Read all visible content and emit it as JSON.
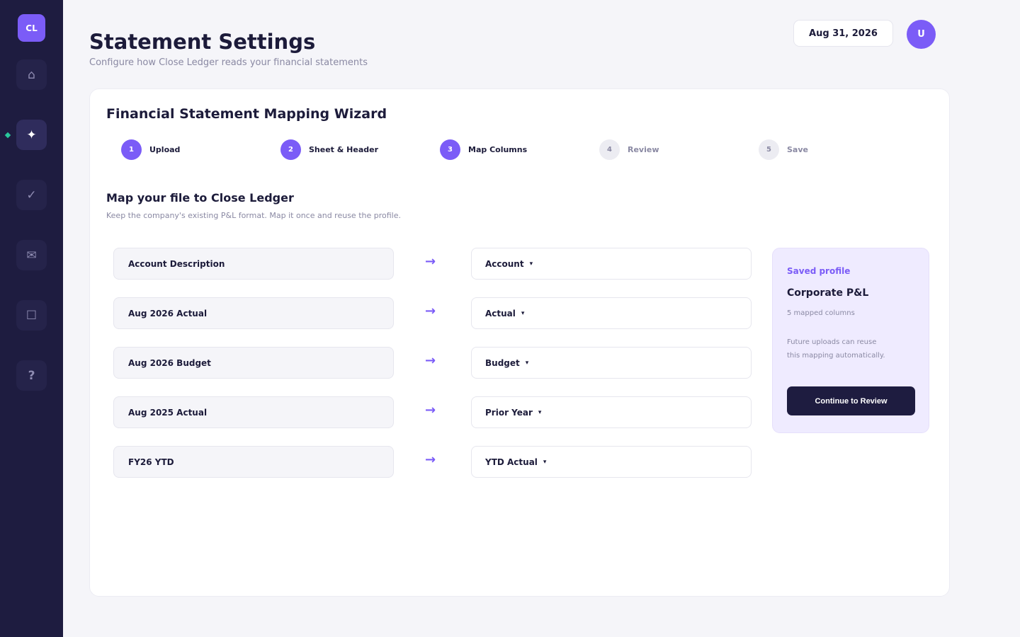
{
  "sidebar": {
    "logo": "CL",
    "items": [
      {
        "name": "home",
        "icon": "⌂"
      },
      {
        "name": "sparkle",
        "icon": "✦"
      },
      {
        "name": "check",
        "icon": "✓"
      },
      {
        "name": "mail",
        "icon": "✉"
      },
      {
        "name": "square",
        "icon": "☐"
      },
      {
        "name": "help",
        "icon": "?"
      }
    ],
    "active_index": 1
  },
  "header": {
    "title": "Statement Settings",
    "subtitle": "Configure how Close Ledger reads your financial statements",
    "date": "Aug 31, 2026",
    "avatar_initial": "U"
  },
  "wizard": {
    "title": "Financial Statement Mapping Wizard",
    "steps": [
      {
        "number": "1",
        "label": "Upload",
        "status": "done"
      },
      {
        "number": "2",
        "label": "Sheet & Header",
        "status": "done"
      },
      {
        "number": "3",
        "label": "Map Columns",
        "status": "done"
      },
      {
        "number": "4",
        "label": "Review",
        "status": "todo"
      },
      {
        "number": "5",
        "label": "Save",
        "status": "todo"
      }
    ],
    "section_title": "Map your file to Close Ledger",
    "section_subtitle": "Keep the company's existing P&L format. Map it once and reuse the profile.",
    "arrow": "→",
    "caret": "▾",
    "mappings": [
      {
        "source": "Account Description",
        "target": "Account"
      },
      {
        "source": "Aug 2026 Actual",
        "target": "Actual"
      },
      {
        "source": "Aug 2026 Budget",
        "target": "Budget"
      },
      {
        "source": "Aug 2025 Actual",
        "target": "Prior Year"
      },
      {
        "source": "FY26 YTD",
        "target": "YTD Actual"
      }
    ]
  },
  "profile": {
    "kicker": "Saved profile",
    "name": "Corporate P&L",
    "count": "5 mapped columns",
    "note_line1": "Future uploads can reuse",
    "note_line2": "this mapping automatically.",
    "cta": "Continue to Review"
  },
  "colors": {
    "accent": "#7b5cf7",
    "sidebar_bg": "#1e1c40",
    "indicator": "#29c79b"
  }
}
